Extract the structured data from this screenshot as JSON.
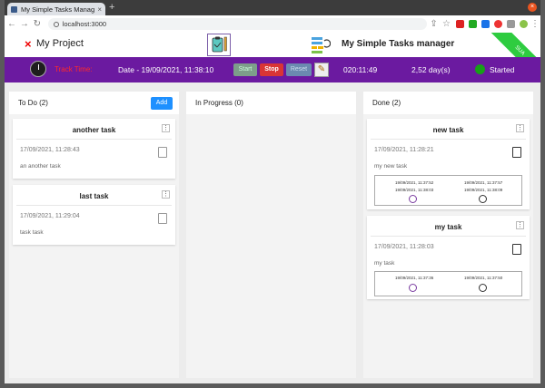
{
  "browser": {
    "tab_title": "My Simple Tasks Manager",
    "tab_close": "×",
    "new_tab": "+",
    "url": "localhost:3000",
    "window_close": "×"
  },
  "header": {
    "project_icon": "×",
    "project_name": "My Project",
    "app_title": "My Simple Tasks manager",
    "ribbon_text": "SUA"
  },
  "trackbar": {
    "label": "Track Time:",
    "date": "Date - 19/09/2021, 11:38:10",
    "start_label": "Start",
    "stop_label": "Stop",
    "reset_label": "Reset",
    "elapsed": "020:11:49",
    "days": "2,52 day(s)",
    "status": "Started",
    "status_color": "#18a018"
  },
  "columns": {
    "todo": {
      "title": "To Do (2)",
      "add_label": "Add",
      "cards": [
        {
          "title": "another task",
          "date": "17/09/2021, 11:28:43",
          "desc": "an another task",
          "menu": "⋮"
        },
        {
          "title": "last task",
          "date": "17/09/2021, 11:29:04",
          "desc": "task task",
          "menu": "⋮"
        }
      ]
    },
    "inprogress": {
      "title": "In Progress (0)"
    },
    "done": {
      "title": "Done (2)",
      "cards": [
        {
          "title": "new task",
          "date": "17/09/2021, 11:28:21",
          "desc": "my new task",
          "menu": "⋮",
          "times": {
            "s1": "19/09/2021, 11:37:52",
            "s2": "19/09/2021, 11:38:03",
            "e1": "19/09/2021, 11:37:57",
            "e2": "19/09/2021, 11:38:09"
          }
        },
        {
          "title": "my task",
          "date": "17/09/2021, 11:28:03",
          "desc": "my task",
          "menu": "⋮",
          "times": {
            "s1": "19/09/2021, 11:37:36",
            "e1": "19/09/2021, 11:37:50"
          }
        }
      ]
    }
  }
}
